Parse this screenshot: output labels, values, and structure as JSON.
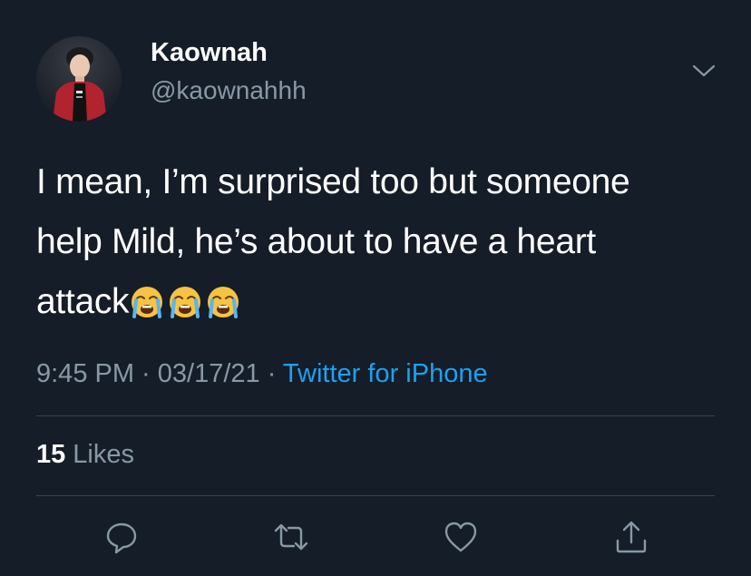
{
  "user": {
    "name": "Kaownah",
    "handle": "@kaownahhh"
  },
  "tweet": {
    "line1": "I mean, I’m surprised too but someone",
    "line2": "help Mild, he’s about to have a heart",
    "line3_text": "attack",
    "emoji_name": "loudly-crying-face",
    "emoji_count": 3
  },
  "meta": {
    "time": "9:45 PM",
    "sep1": " · ",
    "date": "03/17/21",
    "sep2": " · ",
    "source": "Twitter for iPhone"
  },
  "stats": {
    "likes_count": "15",
    "likes_label": "Likes"
  },
  "icons": {
    "menu": "chevron-down-icon",
    "reply": "reply-icon",
    "retweet": "retweet-icon",
    "like": "heart-icon",
    "share": "share-icon"
  },
  "colors": {
    "background": "#151d28",
    "text": "#ffffff",
    "muted": "#8899a6",
    "link": "#1da1f2",
    "divider": "#38444d"
  }
}
